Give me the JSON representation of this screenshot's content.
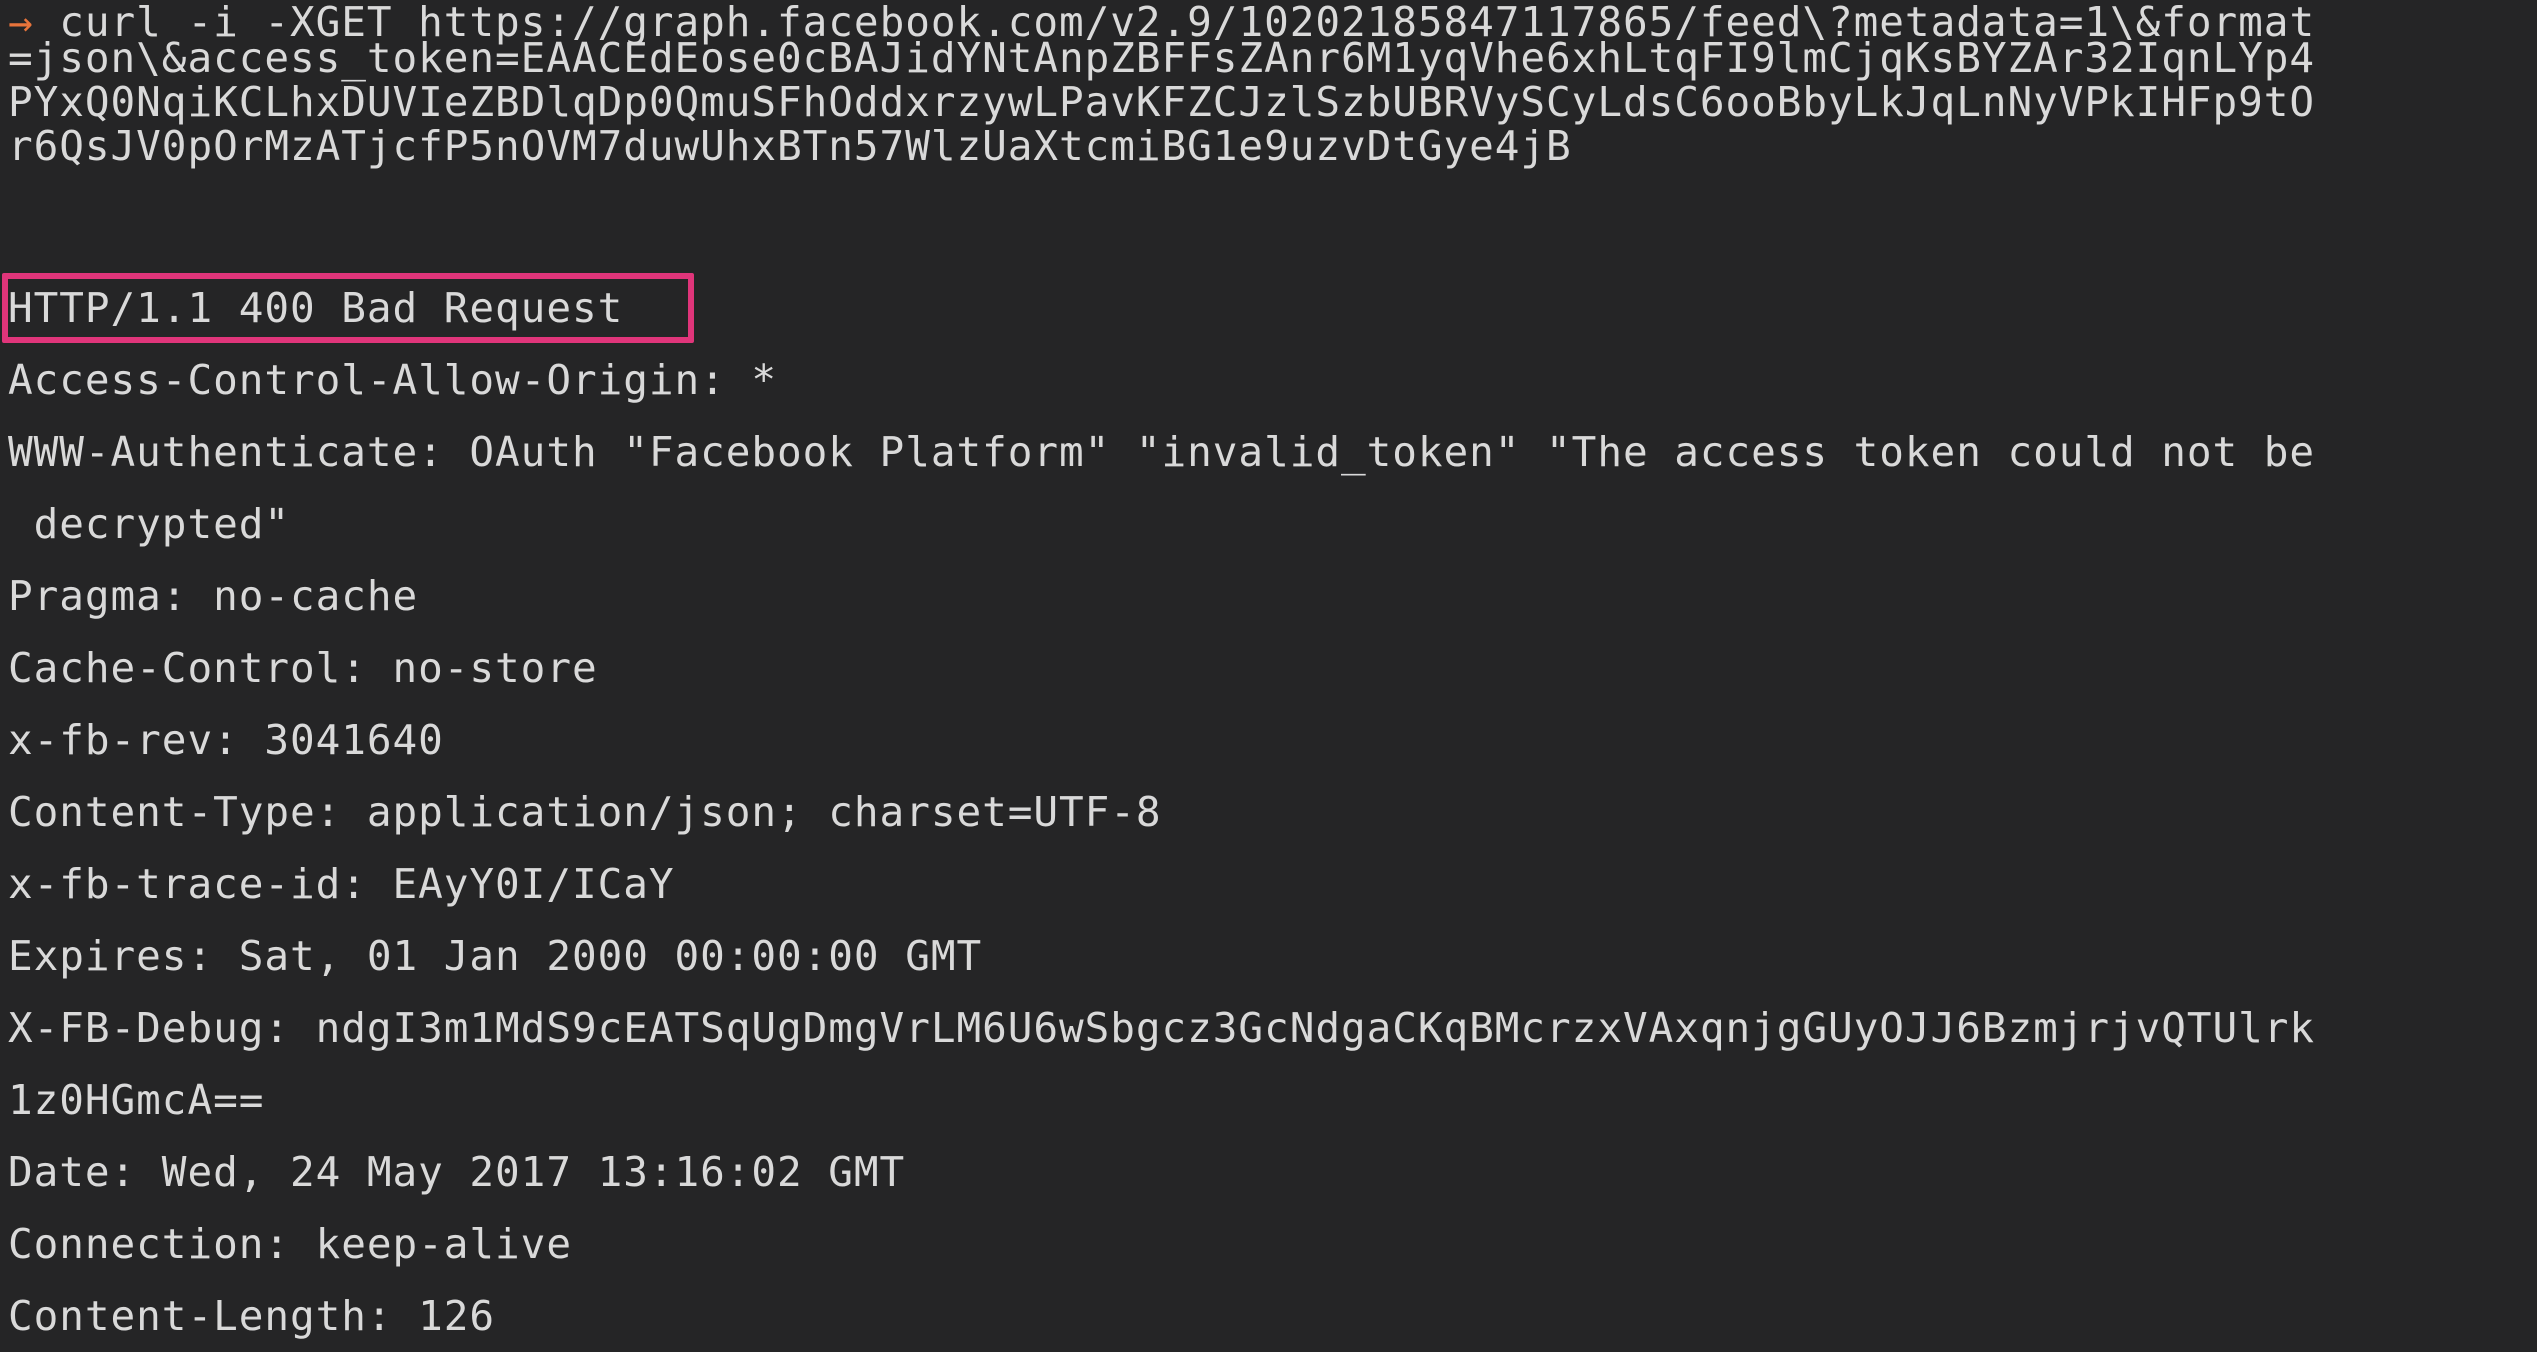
{
  "terminal": {
    "prompt_symbol": "→",
    "command_lines": [
      " curl -i -XGET https://graph.facebook.com/v2.9/10202185847117865/feed\\?metadata=1\\&format",
      "=json\\&access_token=EAACEdEose0cBAJidYNtAnpZBFFsZAnr6M1yqVhe6xhLtqFI9lmCjqKsBYZAr32IqnLYp4",
      "PYxQ0NqiKCLhxDUVIeZBDlqDp0QmuSFhOddxrzywLPavKFZCJzlSzbUBRVySCyLdsC6ooBbyLkJqLnNyVPkIHFp9tO",
      "r6QsJV0pOrMzATjcfP5nOVM7duwUhxBTn57WlzUaXtcmiBG1e9uzvDtGye4jB"
    ],
    "status_line": "HTTP/1.1 400 Bad Request",
    "response_lines": [
      "Access-Control-Allow-Origin: *",
      "WWW-Authenticate: OAuth \"Facebook Platform\" \"invalid_token\" \"The access token could not be",
      " decrypted\"",
      "Pragma: no-cache",
      "Cache-Control: no-store",
      "x-fb-rev: 3041640",
      "Content-Type: application/json; charset=UTF-8",
      "x-fb-trace-id: EAyY0I/ICaY",
      "Expires: Sat, 01 Jan 2000 00:00:00 GMT",
      "X-FB-Debug: ndgI3m1MdS9cEATSqUgDmgVrLM6U6wSbgcz3GcNdgaCKqBMcrzxVAxqnjgGUyOJJ6BzmjrjvQTUlrk",
      "1z0HGmcA==",
      "Date: Wed, 24 May 2017 13:16:02 GMT",
      "Connection: keep-alive",
      "Content-Length: 126"
    ],
    "colors": {
      "background": "#252526",
      "text": "#d9d9d9",
      "prompt": "#e8743b",
      "highlight_border": "#e0357a"
    }
  }
}
